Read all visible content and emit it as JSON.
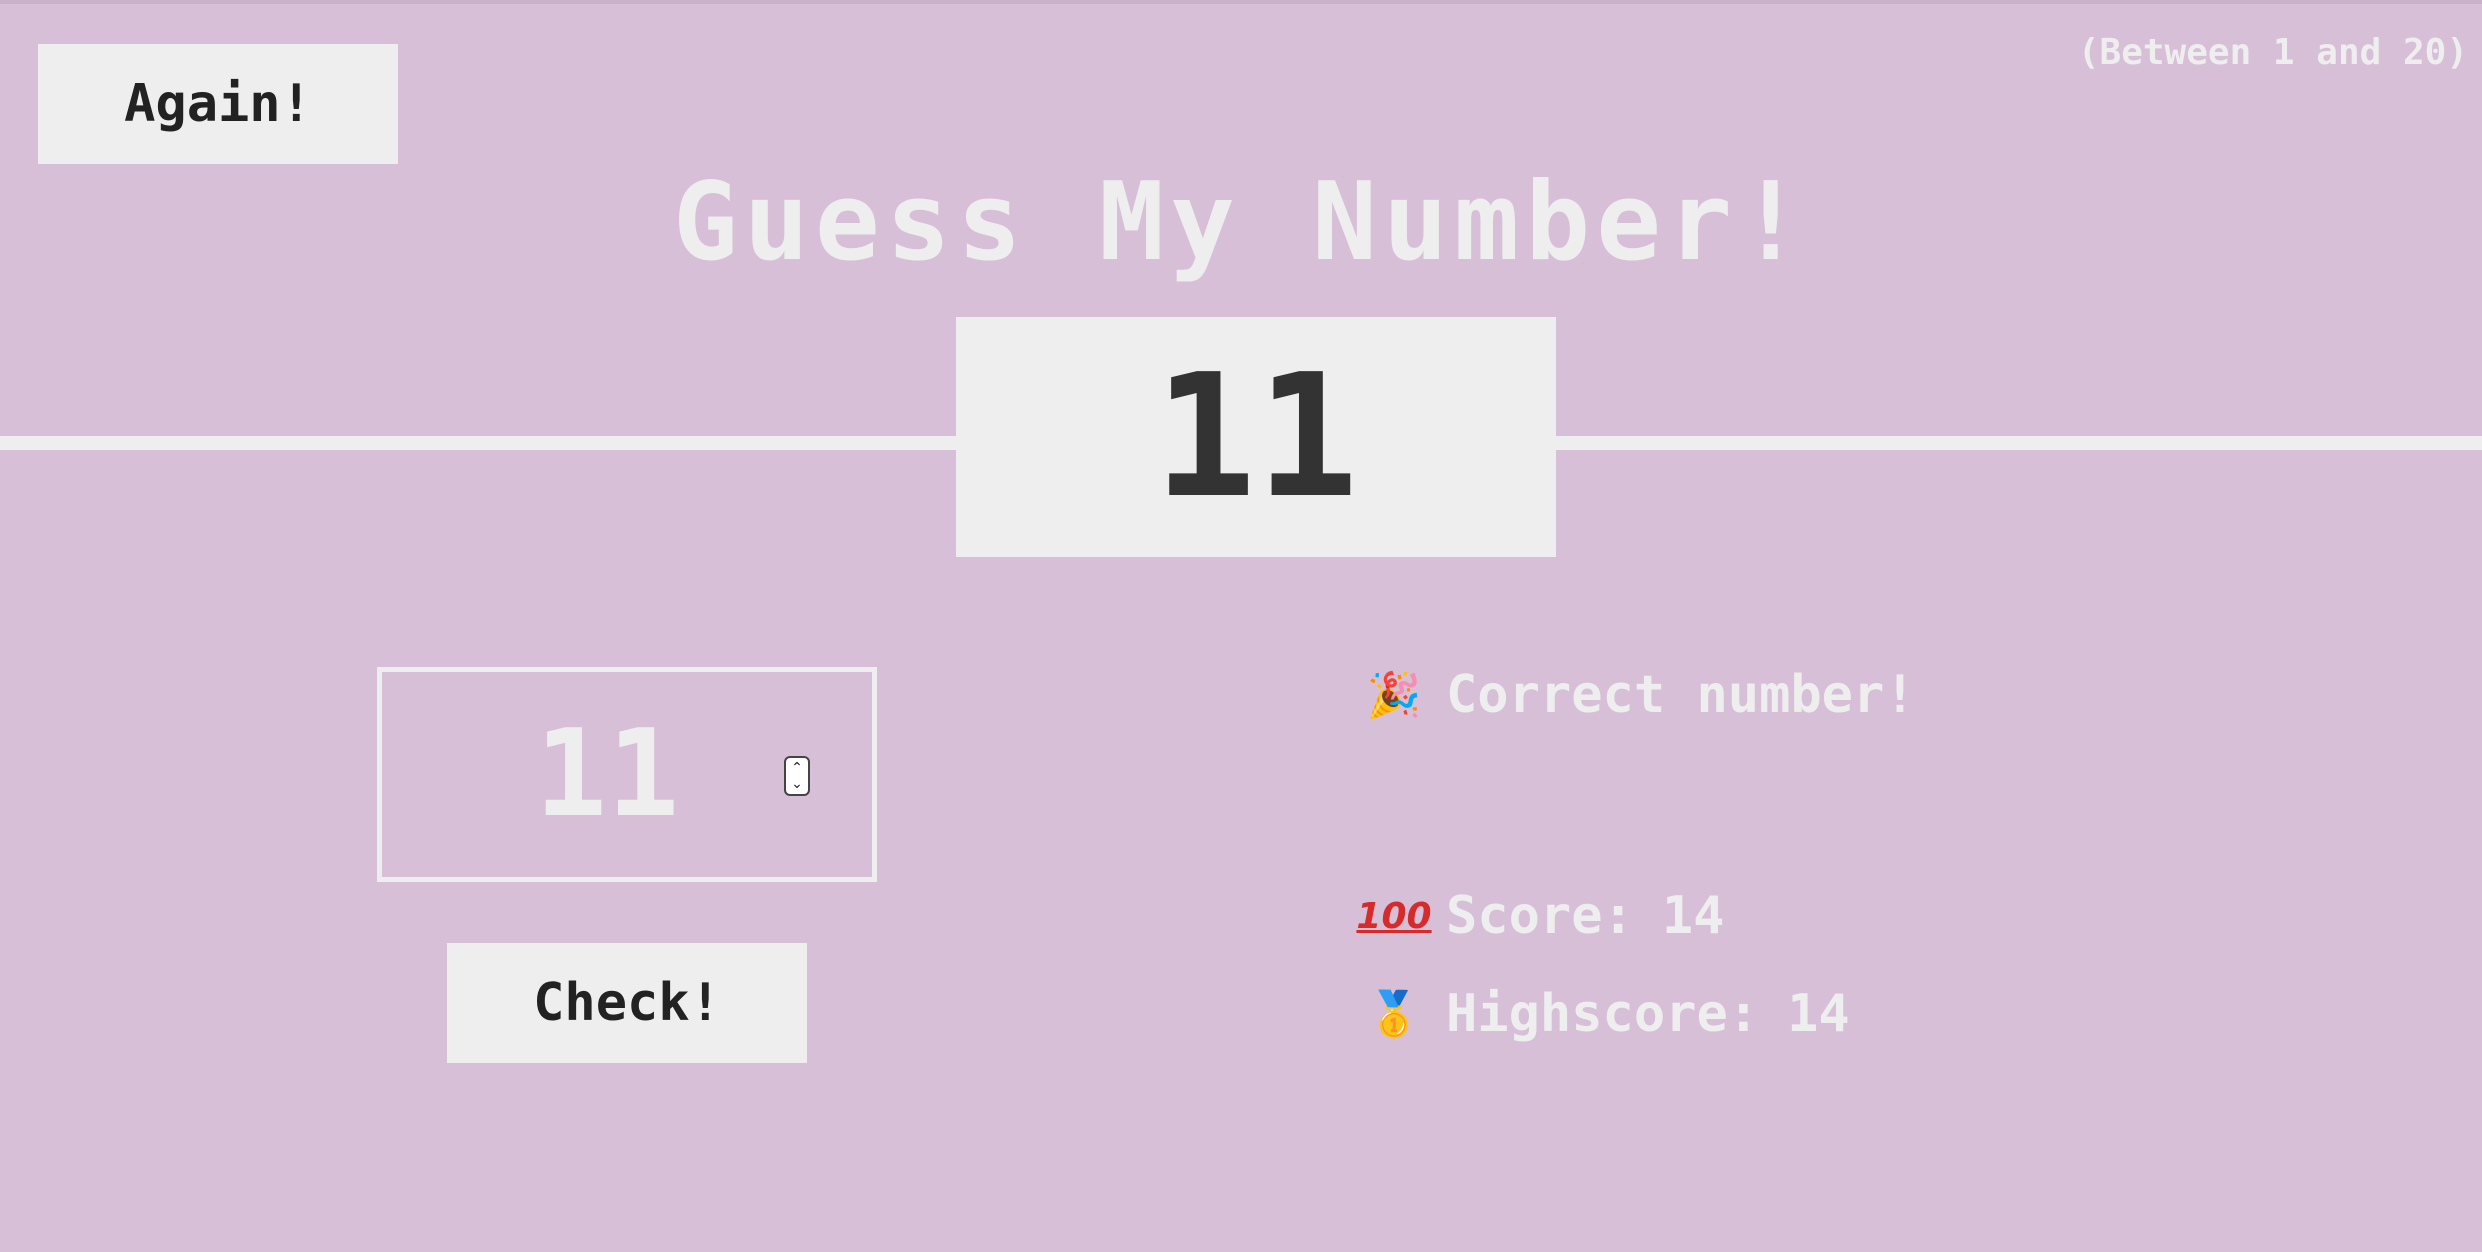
{
  "header": {
    "again_label": "Again!",
    "range_hint": "(Between 1 and 20)",
    "title": "Guess My Number!"
  },
  "secret": {
    "number": "11"
  },
  "guess": {
    "value": "11",
    "spinner_up": "⌃",
    "spinner_down": "⌄"
  },
  "controls": {
    "check_label": "Check!"
  },
  "stats": {
    "message_icon": "party-popper-icon",
    "message": "Correct number!",
    "score_icon": "hundred-points-icon",
    "score_label": "Score:",
    "score_value": "14",
    "highscore_icon": "first-place-medal-icon",
    "highscore_label": "Highscore:",
    "highscore_value": "14"
  },
  "colors": {
    "background": "#d8bfd8",
    "foreground": "#eeeeee",
    "dark_text": "#333333"
  }
}
